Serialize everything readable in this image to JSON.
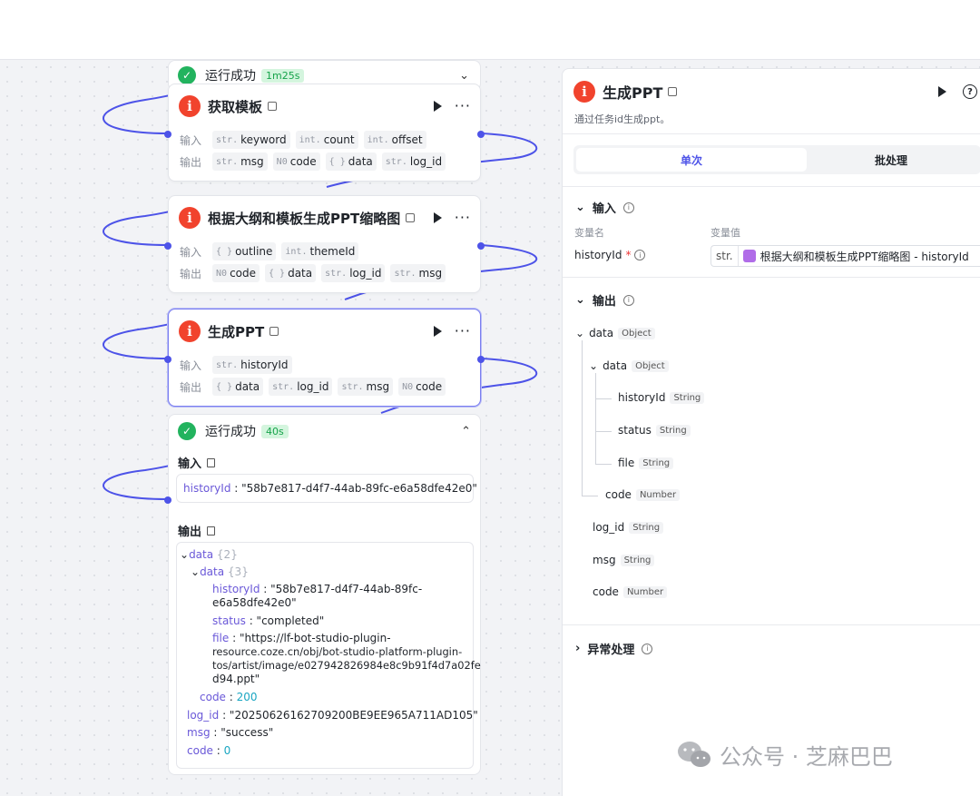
{
  "canvas": {
    "run_top": {
      "status": "运行成功",
      "time": "1m25s"
    },
    "nodes": [
      {
        "title": "获取模板",
        "input_label": "输入",
        "output_label": "输出",
        "inputs": [
          {
            "t": "str.",
            "n": "keyword"
          },
          {
            "t": "int.",
            "n": "count"
          },
          {
            "t": "int.",
            "n": "offset"
          }
        ],
        "outputs": [
          {
            "t": "str.",
            "n": "msg"
          },
          {
            "t": "N0",
            "n": "code"
          },
          {
            "t": "{ }",
            "n": "data"
          },
          {
            "t": "str.",
            "n": "log_id"
          }
        ]
      },
      {
        "title": "根据大纲和模板生成PPT缩略图",
        "input_label": "输入",
        "output_label": "输出",
        "inputs": [
          {
            "t": "{ }",
            "n": "outline"
          },
          {
            "t": "int.",
            "n": "themeId"
          }
        ],
        "outputs": [
          {
            "t": "N0",
            "n": "code"
          },
          {
            "t": "{ }",
            "n": "data"
          },
          {
            "t": "str.",
            "n": "log_id"
          },
          {
            "t": "str.",
            "n": "msg"
          }
        ]
      },
      {
        "title": "生成PPT",
        "input_label": "输入",
        "output_label": "输出",
        "inputs": [
          {
            "t": "str.",
            "n": "historyId"
          }
        ],
        "outputs": [
          {
            "t": "{ }",
            "n": "data"
          },
          {
            "t": "str.",
            "n": "log_id"
          },
          {
            "t": "str.",
            "n": "msg"
          },
          {
            "t": "N0",
            "n": "code"
          }
        ]
      }
    ],
    "run_result": {
      "status": "运行成功",
      "time": "40s",
      "input_title": "输入",
      "input_key": "historyId",
      "input_value": "\"58b7e817-d4f7-44ab-89fc-e6a58dfe42e0\"",
      "output_title": "输出",
      "tree": {
        "data_key": "data",
        "data_count": "{2}",
        "inner_key": "data",
        "inner_count": "{3}",
        "historyId_key": "historyId",
        "historyId_v1": "\"58b7e817-d4f7-44ab-89fc-",
        "historyId_v2": "e6a58dfe42e0\"",
        "status_key": "status",
        "status_v": "\"completed\"",
        "file_key": "file",
        "file_v1": "\"https://lf-bot-studio-plugin-",
        "file_v2": "resource.coze.cn/obj/bot-studio-platform-plugin-",
        "file_v3": "tos/artist/image/e027942826984e8c9b91f4d7a02fe",
        "file_v4": "d94.ppt\"",
        "code_key": "code",
        "code_v": "200",
        "log_key": "log_id",
        "log_v": "\"20250626162709200BE9EE965A711AD105\"",
        "msg_key": "msg",
        "msg_v": "\"success\"",
        "code2_key": "code",
        "code2_v": "0"
      }
    }
  },
  "panel": {
    "title": "生成PPT",
    "description": "通过任务id生成ppt。",
    "tabs": [
      "单次",
      "批处理"
    ],
    "input_section": "输入",
    "col_var_name": "变量名",
    "col_var_value": "变量值",
    "param_name": "historyId",
    "param_required": "*",
    "param_type": "str.",
    "param_ref": "根据大纲和模板生成PPT缩略图 - historyId",
    "output_section": "输出",
    "outputs": {
      "data": {
        "name": "data",
        "type": "Object"
      },
      "inner_data": {
        "name": "data",
        "type": "Object"
      },
      "historyId": {
        "name": "historyId",
        "type": "String"
      },
      "status": {
        "name": "status",
        "type": "String"
      },
      "file": {
        "name": "file",
        "type": "String"
      },
      "code_inner": {
        "name": "code",
        "type": "Number"
      },
      "log_id": {
        "name": "log_id",
        "type": "String"
      },
      "msg": {
        "name": "msg",
        "type": "String"
      },
      "code": {
        "name": "code",
        "type": "Number"
      }
    },
    "exception_section": "异常处理"
  },
  "watermark": {
    "text": "公众号 · 芝麻巴巴"
  },
  "colors": {
    "accent": "#4d53e8",
    "success": "#22b35e",
    "plugin": "#f1432d"
  }
}
